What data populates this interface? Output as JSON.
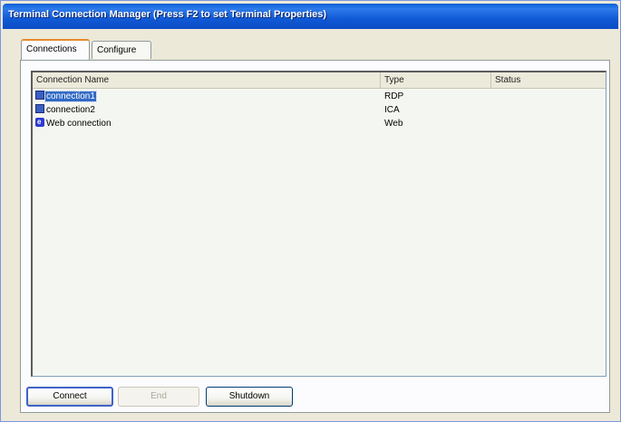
{
  "window": {
    "title": "Terminal Connection Manager (Press F2 to set Terminal Properties)"
  },
  "tabs": [
    {
      "label": "Connections",
      "active": true
    },
    {
      "label": "Configure",
      "active": false
    }
  ],
  "list": {
    "columns": [
      "Connection Name",
      "Type",
      "Status"
    ],
    "rows": [
      {
        "name": "connection1",
        "type": "RDP",
        "status": "",
        "icon": "monitor-icon",
        "selected": true
      },
      {
        "name": "connection2",
        "type": "ICA",
        "status": "",
        "icon": "monitor-icon",
        "selected": false
      },
      {
        "name": "Web connection",
        "type": "Web",
        "status": "",
        "icon": "web-browser-icon",
        "selected": false
      }
    ]
  },
  "buttons": {
    "connect": "Connect",
    "end": "End",
    "shutdown": "Shutdown"
  },
  "colors": {
    "titlebar": "#0b4cc4",
    "selection": "#316ac5",
    "tab_highlight": "#e68b2c"
  }
}
